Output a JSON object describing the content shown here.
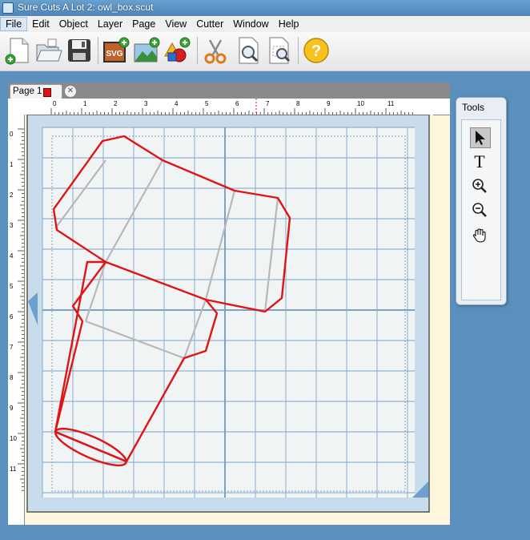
{
  "window": {
    "title": "Sure Cuts A Lot 2: owl_box.scut"
  },
  "menu": {
    "items": [
      "File",
      "Edit",
      "Object",
      "Layer",
      "Page",
      "View",
      "Cutter",
      "Window",
      "Help"
    ],
    "active": "File"
  },
  "toolbar": {
    "buttons": [
      {
        "name": "new-document-icon"
      },
      {
        "name": "open-folder-icon"
      },
      {
        "name": "save-disk-icon"
      },
      {
        "name": "import-svg-icon",
        "label": "SVG"
      },
      {
        "name": "import-image-icon"
      },
      {
        "name": "add-shapes-icon"
      },
      {
        "name": "cut-scissors-icon"
      },
      {
        "name": "preview-page-icon"
      },
      {
        "name": "preview-cut-icon"
      },
      {
        "name": "help-icon",
        "label": "?"
      }
    ]
  },
  "tabs": [
    {
      "label": "Page 1",
      "color": "#e01414"
    }
  ],
  "ruler": {
    "horizontal": [
      "0",
      "1",
      "2",
      "3",
      "4",
      "5",
      "6",
      "7",
      "8",
      "9",
      "10",
      "11"
    ],
    "vertical": [
      "0",
      "1",
      "2",
      "3",
      "4",
      "5",
      "6",
      "7",
      "8",
      "9",
      "10",
      "11"
    ]
  },
  "tools_panel": {
    "title": "Tools",
    "tools": [
      {
        "name": "select-arrow-icon",
        "selected": true
      },
      {
        "name": "text-tool-icon",
        "label": "T"
      },
      {
        "name": "zoom-in-icon"
      },
      {
        "name": "zoom-out-icon"
      },
      {
        "name": "pan-hand-icon"
      }
    ]
  },
  "colors": {
    "desktop": "#5b8fbd",
    "cut_line": "#e01414",
    "fold_line": "#b8b8b8",
    "mat": "#c9dcec",
    "grid": "#7aa3c8"
  }
}
